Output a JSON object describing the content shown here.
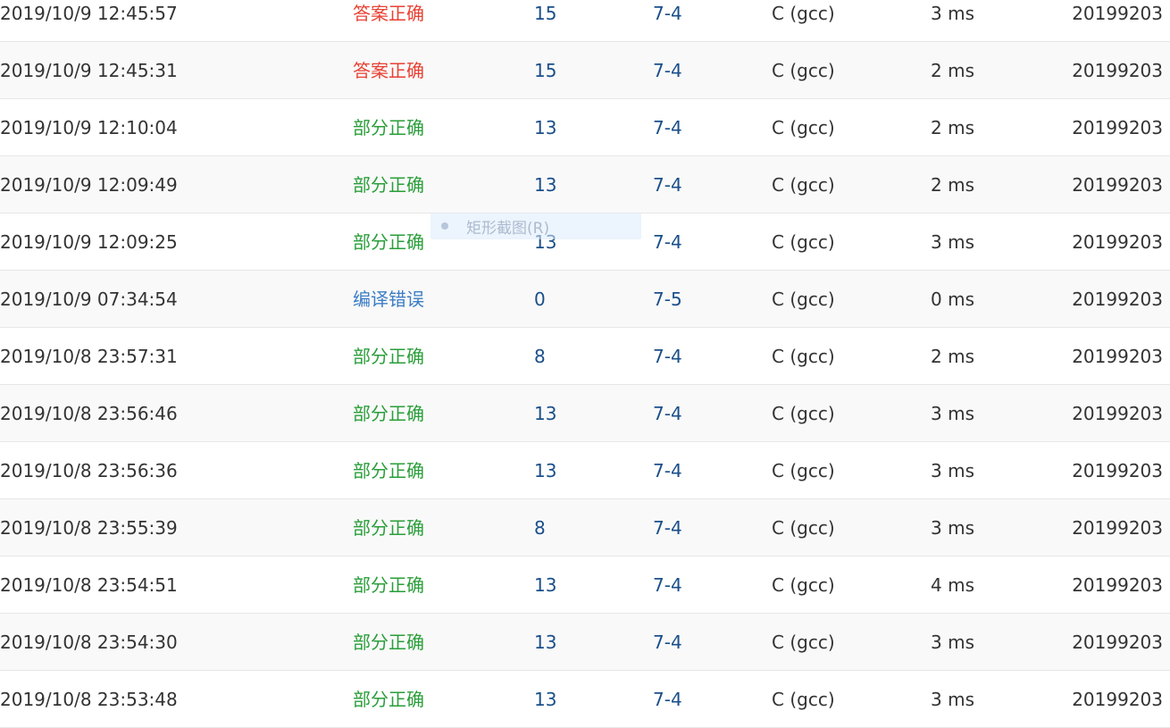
{
  "colors": {
    "accepted": "#e84133",
    "partial": "#2a9e3a",
    "compile_error": "#3b7dc4",
    "link_blue": "#1a4f8a"
  },
  "rows": [
    {
      "time": "2019/10/9 12:45:57",
      "status": "答案正确",
      "status_type": "accepted",
      "score": "15",
      "problem": "7-4",
      "lang": "C (gcc)",
      "duration": "3 ms",
      "user": "20199203"
    },
    {
      "time": "2019/10/9 12:45:31",
      "status": "答案正确",
      "status_type": "accepted",
      "score": "15",
      "problem": "7-4",
      "lang": "C (gcc)",
      "duration": "2 ms",
      "user": "20199203"
    },
    {
      "time": "2019/10/9 12:10:04",
      "status": "部分正确",
      "status_type": "partial",
      "score": "13",
      "problem": "7-4",
      "lang": "C (gcc)",
      "duration": "2 ms",
      "user": "20199203"
    },
    {
      "time": "2019/10/9 12:09:49",
      "status": "部分正确",
      "status_type": "partial",
      "score": "13",
      "problem": "7-4",
      "lang": "C (gcc)",
      "duration": "2 ms",
      "user": "20199203"
    },
    {
      "time": "2019/10/9 12:09:25",
      "status": "部分正确",
      "status_type": "partial",
      "score": "13",
      "problem": "7-4",
      "lang": "C (gcc)",
      "duration": "3 ms",
      "user": "20199203"
    },
    {
      "time": "2019/10/9 07:34:54",
      "status": "编译错误",
      "status_type": "compile_error",
      "score": "0",
      "problem": "7-5",
      "lang": "C (gcc)",
      "duration": "0 ms",
      "user": "20199203"
    },
    {
      "time": "2019/10/8 23:57:31",
      "status": "部分正确",
      "status_type": "partial",
      "score": "8",
      "problem": "7-4",
      "lang": "C (gcc)",
      "duration": "2 ms",
      "user": "20199203"
    },
    {
      "time": "2019/10/8 23:56:46",
      "status": "部分正确",
      "status_type": "partial",
      "score": "13",
      "problem": "7-4",
      "lang": "C (gcc)",
      "duration": "3 ms",
      "user": "20199203"
    },
    {
      "time": "2019/10/8 23:56:36",
      "status": "部分正确",
      "status_type": "partial",
      "score": "13",
      "problem": "7-4",
      "lang": "C (gcc)",
      "duration": "3 ms",
      "user": "20199203"
    },
    {
      "time": "2019/10/8 23:55:39",
      "status": "部分正确",
      "status_type": "partial",
      "score": "8",
      "problem": "7-4",
      "lang": "C (gcc)",
      "duration": "3 ms",
      "user": "20199203"
    },
    {
      "time": "2019/10/8 23:54:51",
      "status": "部分正确",
      "status_type": "partial",
      "score": "13",
      "problem": "7-4",
      "lang": "C (gcc)",
      "duration": "4 ms",
      "user": "20199203"
    },
    {
      "time": "2019/10/8 23:54:30",
      "status": "部分正确",
      "status_type": "partial",
      "score": "13",
      "problem": "7-4",
      "lang": "C (gcc)",
      "duration": "3 ms",
      "user": "20199203"
    },
    {
      "time": "2019/10/8 23:53:48",
      "status": "部分正确",
      "status_type": "partial",
      "score": "13",
      "problem": "7-4",
      "lang": "C (gcc)",
      "duration": "3 ms",
      "user": "20199203"
    }
  ],
  "overlay": {
    "label": "矩形截图(R)",
    "icon": "record-dot-icon"
  }
}
